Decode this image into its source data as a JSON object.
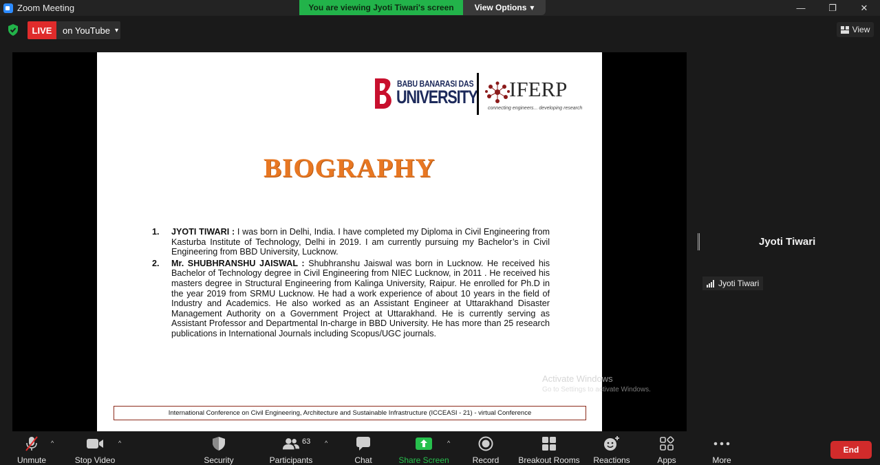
{
  "titlebar": {
    "title": "Zoom Meeting",
    "minimize_icon": "—",
    "restore_icon": "❐",
    "close_icon": "✕"
  },
  "banner": {
    "viewing_text": "You are viewing Jyoti Tiwari's screen",
    "view_options_label": "View Options",
    "caret": "▾"
  },
  "live": {
    "badge": "LIVE",
    "target": "on YouTube",
    "caret": "▾"
  },
  "view_button": {
    "label": "View"
  },
  "slide": {
    "logo": {
      "bbd_line1": "BABU BANARASI DAS",
      "bbd_line2": "UNIVERSITY",
      "iferp": "IFERP",
      "iferp_tagline": "connecting engineers... developing research"
    },
    "title": "BIOGRAPHY",
    "items": [
      {
        "number": "1.",
        "name": "JYOTI TIWARI :",
        "text": " I was born  in Delhi, India.  I have completed my Diploma in Civil Engineering from Kasturba Institute of Technology, Delhi in 2019. I am currently pursuing my Bachelor’s in Civil Engineering from BBD University, Lucknow."
      },
      {
        "number": "2.",
        "name": "Mr. SHUBHRANSHU JAISWAL :",
        "text": " Shubhranshu Jaiswal was born in Lucknow. He received his Bachelor of Technology degree in Civil Engineering from NIEC Lucknow, in 2011 . He received his masters degree in Structural Engineering from Kalinga University, Raipur. He enrolled for Ph.D in the year 2019 from SRMU Lucknow. He had a work experience of about 10 years in the field of Industry and Academics. He also worked as an Assistant Engineer at Uttarakhand Disaster Management Authority on a Government Project at Uttarakhand. He is currently serving as Assistant Professor and Departmental In-charge in BBD University. He has more than 25 research publications in International Journals including Scopus/UGC journals."
      }
    ],
    "footer": "International Conference on Civil Engineering, Architecture and Sustainable Infrastructure (ICCEASI - 21) - virtual Conference"
  },
  "watermark": {
    "line1": "Activate Windows",
    "line2": "Go to Settings to activate Windows."
  },
  "right_panel": {
    "speaker_name": "Jyoti Tiwari",
    "name_tag": "Jyoti Tiwari"
  },
  "toolbar": {
    "unmute": "Unmute",
    "stop_video": "Stop Video",
    "security": "Security",
    "participants": "Participants",
    "participants_count": "63",
    "chat": "Chat",
    "share_screen": "Share Screen",
    "record": "Record",
    "breakout_rooms": "Breakout Rooms",
    "reactions": "Reactions",
    "apps": "Apps",
    "more": "More",
    "end": "End",
    "caret_up": "^"
  },
  "colors": {
    "live_red": "#e02b2b",
    "banner_green": "#22b34a",
    "share_green": "#27c04d",
    "title_orange": "#e87722",
    "end_red": "#d22b2b"
  }
}
